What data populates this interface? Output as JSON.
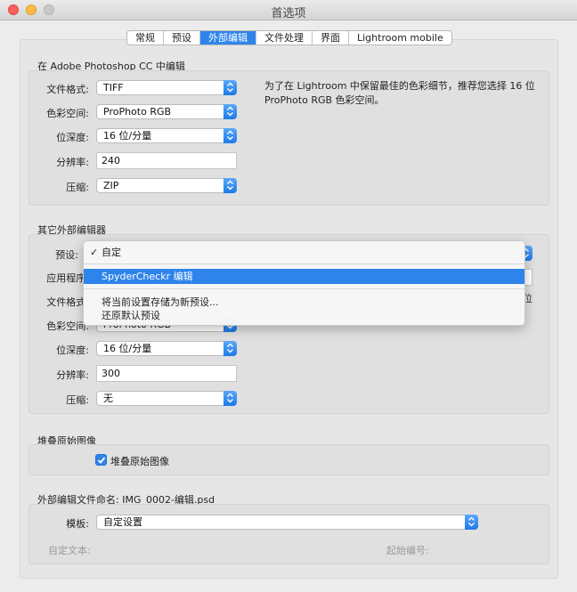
{
  "window": {
    "title": "首选项"
  },
  "tabs": [
    {
      "label": "常规"
    },
    {
      "label": "预设"
    },
    {
      "label": "外部编辑"
    },
    {
      "label": "文件处理"
    },
    {
      "label": "界面"
    },
    {
      "label": "Lightroom mobile"
    }
  ],
  "active_tab": "外部编辑",
  "photoshop_section": {
    "heading": "在 Adobe Photoshop CC 中编辑",
    "file_format_label": "文件格式:",
    "file_format_value": "TIFF",
    "color_space_label": "色彩空间:",
    "color_space_value": "ProPhoto RGB",
    "bit_depth_label": "位深度:",
    "bit_depth_value": "16 位/分量",
    "resolution_label": "分辨率:",
    "resolution_value": "240",
    "compression_label": "压缩:",
    "compression_value": "ZIP",
    "hint": "为了在 Lightroom 中保留最佳的色彩细节，推荐您选择 16 位 ProPhoto RGB 色彩空间。"
  },
  "other_editor_section": {
    "heading": "其它外部编辑器",
    "preset_label": "预设:",
    "app_label": "应用程序:",
    "file_format_label": "文件格式:",
    "color_space_label": "色彩空间:",
    "color_space_value": "ProPhoto RGB",
    "hint_tail": "位",
    "bit_depth_label": "位深度:",
    "bit_depth_value": "16 位/分量",
    "resolution_label": "分辨率:",
    "resolution_value": "300",
    "compression_label": "压缩:",
    "compression_value": "无"
  },
  "preset_menu": {
    "items": [
      {
        "label": "自定",
        "checked": true
      },
      {
        "label": "SpyderCheckr 编辑",
        "highlighted": true
      },
      {
        "label": "将当前设置存储为新预设..."
      },
      {
        "label": "还原默认预设"
      }
    ]
  },
  "stack_section": {
    "heading": "堆叠原始图像",
    "checkbox_label": "堆叠原始图像",
    "checked": true
  },
  "naming_section": {
    "heading": "外部编辑文件命名: IMG_0002-编辑.psd",
    "template_label": "模板:",
    "template_value": "自定设置",
    "custom_text_label": "自定文本:",
    "start_number_label": "起始编号:"
  },
  "colors": {
    "accent": "#2e84eb"
  }
}
